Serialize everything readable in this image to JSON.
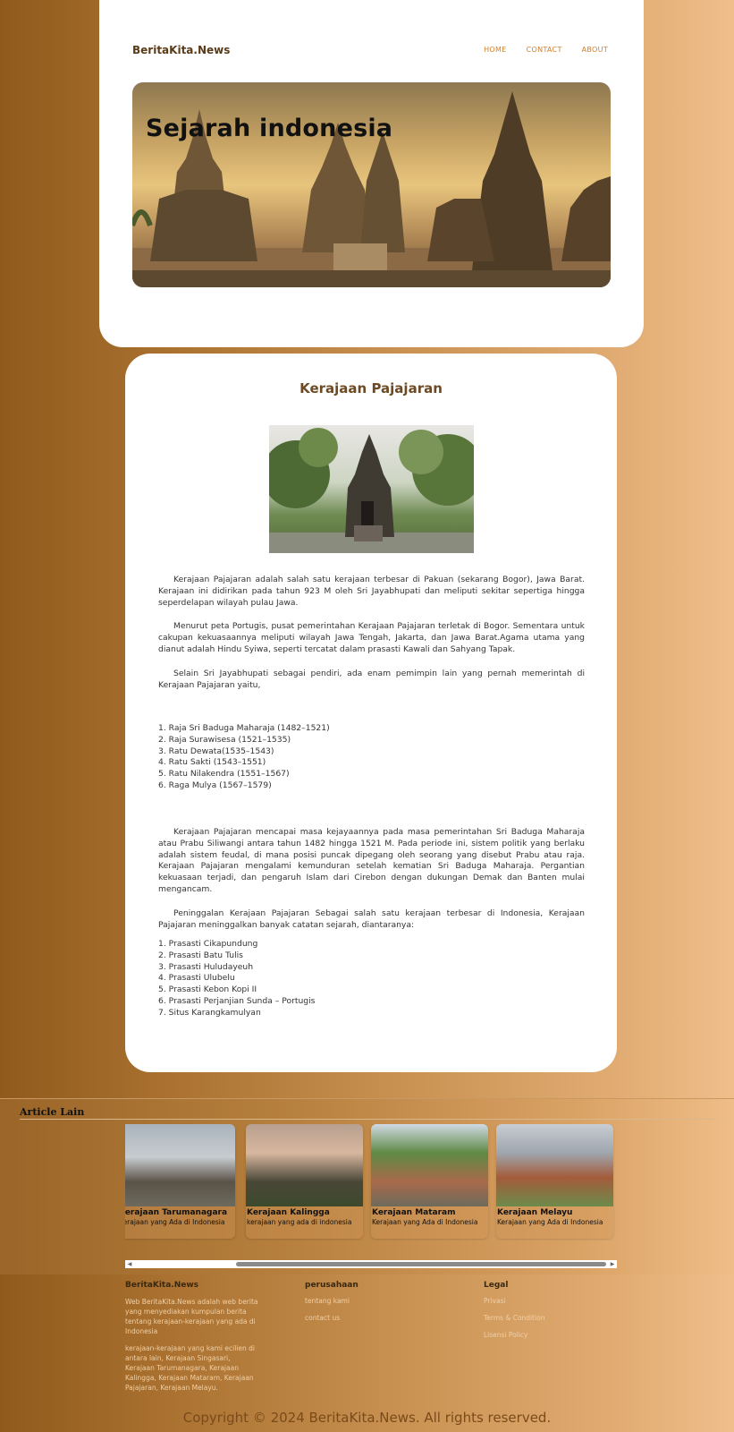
{
  "header": {
    "brand": "BeritaKita.News",
    "nav": [
      "HOME",
      "CONTACT",
      "ABOUT"
    ],
    "banner_title": "Sejarah indonesia"
  },
  "article": {
    "title": "Kerajaan Pajajaran",
    "paragraphs_a": [
      "Kerajaan Pajajaran adalah salah satu kerajaan terbesar di Pakuan (sekarang Bogor), Jawa Barat. Kerajaan ini didirikan pada tahun 923 M oleh Sri Jayabhupati dan meliputi sekitar sepertiga hingga seperdelapan wilayah pulau Jawa.",
      "Menurut peta Portugis, pusat pemerintahan Kerajaan Pajajaran terletak di Bogor. Sementara untuk cakupan kekuasaannya meliputi wilayah Jawa Tengah, Jakarta, dan Jawa Barat.Agama utama yang dianut adalah Hindu Syiwa, seperti tercatat dalam prasasti Kawali dan Sahyang Tapak.",
      "Selain Sri Jayabhupati sebagai pendiri, ada enam pemimpin lain yang pernah memerintah di Kerajaan Pajajaran yaitu,"
    ],
    "rulers": [
      "1. Raja Sri Baduga Maharaja (1482–1521)",
      "2. Raja Surawisesa (1521–1535)",
      "3. Ratu Dewata(1535–1543)",
      "4. Ratu Sakti (1543–1551)",
      "5. Ratu Nilakendra (1551–1567)",
      "6. Raga Mulya (1567–1579)"
    ],
    "paragraphs_b": [
      "Kerajaan Pajajaran mencapai masa kejayaannya pada masa pemerintahan Sri Baduga Maharaja atau Prabu Siliwangi antara tahun 1482 hingga 1521 M. Pada periode ini, sistem politik yang berlaku adalah sistem feudal, di mana posisi puncak dipegang oleh seorang yang disebut Prabu atau raja. Kerajaan Pajajaran mengalami kemunduran setelah kematian Sri Baduga Maharaja. Pergantian kekuasaan terjadi, dan pengaruh Islam dari Cirebon dengan dukungan Demak dan Banten mulai mengancam.",
      "Peninggalan Kerajaan Pajajaran Sebagai salah satu kerajaan terbesar di Indonesia, Kerajaan Pajajaran meninggalkan banyak catatan sejarah, diantaranya:"
    ],
    "relics": [
      "1. Prasasti Cikapundung",
      "2. Prasasti Batu Tulis",
      "3. Prasasti Huludayeuh",
      "4. Prasasti Ulubelu",
      "5. Prasasti Kebon Kopi II",
      "6. Prasasti Perjanjian Sunda – Portugis",
      "7. Situs Karangkamulyan"
    ]
  },
  "other_articles": {
    "title": "Article Lain",
    "cards": [
      {
        "title": "Kerajaan Tarumanagara",
        "subtitle": "Kerajaan yang Ada di Indonesia"
      },
      {
        "title": "Kerajaan Kalingga",
        "subtitle": "kerajaan yang ada di indonesia"
      },
      {
        "title": "Kerajaan Mataram",
        "subtitle": "Kerajaan yang Ada di Indonesia"
      },
      {
        "title": "Kerajaan Melayu",
        "subtitle": "Kerajaan yang Ada di Indonesia"
      }
    ]
  },
  "footer": {
    "brand": "BeritaKita.News",
    "about_1": "Web BeritaKita.News adalah web berita yang menyediakan kumpulan berita tentang kerajaan-kerajaan yang ada di Indonesia",
    "about_2": "kerajaan-kerajaan yang kami ecilien di antara lain, Kerajaan Singasari, Kerajaan Tarumanagara, Kerajaan Kalingga, Kerajaan Mataram, Kerajaan Pajajaran, Kerajaan Melayu.",
    "company_title": "perusahaan",
    "company_links": [
      "tentang kami",
      "contact us"
    ],
    "legal_title": "Legal",
    "legal_links": [
      "Privasi",
      "Terms & Condition",
      "Lisensi Policy"
    ],
    "copyright": "Copyright © 2024 BeritaKita.News. All rights reserved."
  }
}
